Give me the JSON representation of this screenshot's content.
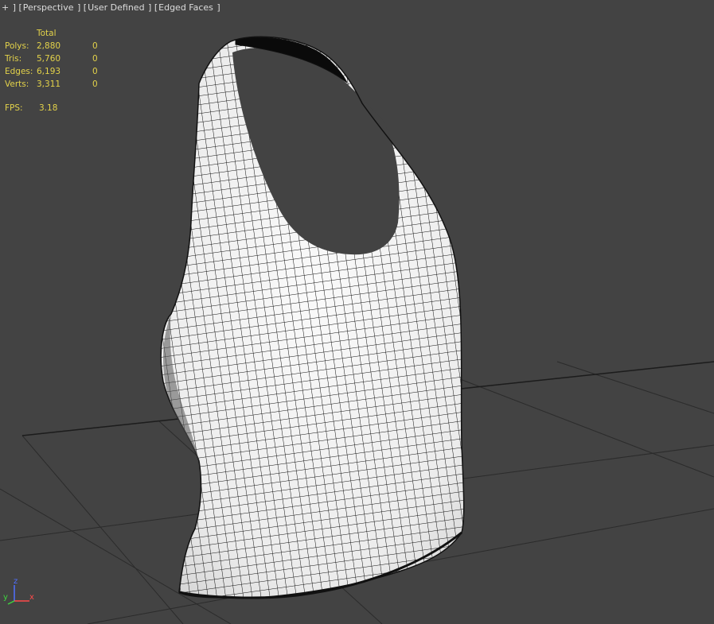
{
  "viewport": {
    "label_plus": "+",
    "label_view": "Perspective",
    "label_shading": "User Defined",
    "label_display": "Edged Faces"
  },
  "stats": {
    "header_total": "Total",
    "rows": [
      {
        "label": "Polys:",
        "total": "2,880",
        "selected": "0"
      },
      {
        "label": "Tris:",
        "total": "5,760",
        "selected": "0"
      },
      {
        "label": "Edges:",
        "total": "6,193",
        "selected": "0"
      },
      {
        "label": "Verts:",
        "total": "3,311",
        "selected": "0"
      }
    ],
    "fps_label": "FPS:",
    "fps_value": "3.18"
  },
  "axis_gizmo": {
    "x": "x",
    "y": "y",
    "z": "z"
  },
  "colors": {
    "background": "#434343",
    "grid": "#2a2a2a",
    "stats_text": "#e3d24a",
    "mesh_fill": "#f2f2f2",
    "mesh_wire": "#111111"
  }
}
